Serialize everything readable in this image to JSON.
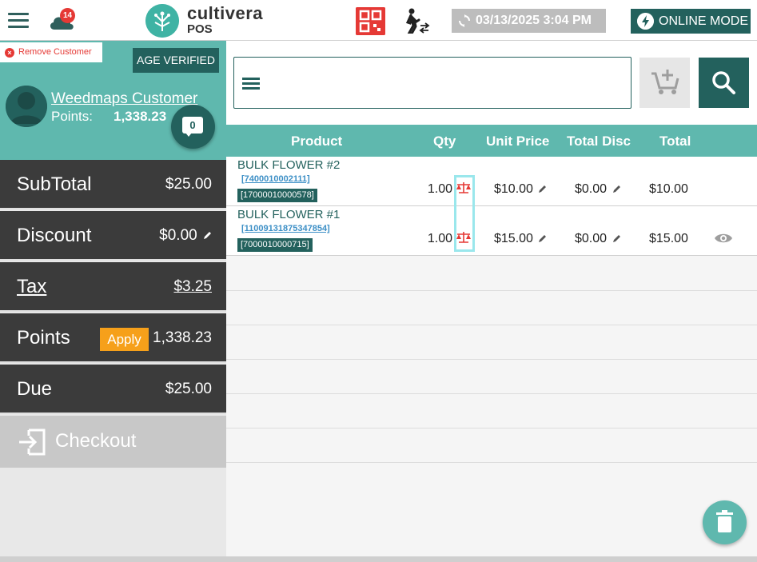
{
  "header": {
    "cloud_badge": "14",
    "logo_text": "cultivera",
    "logo_sub": "POS",
    "datetime": "03/13/2025 3:04 PM",
    "mode_label": "ONLINE MODE"
  },
  "customer": {
    "remove_label": "Remove Customer",
    "age_badge": "AGE VERIFIED",
    "name": "Weedmaps Customer",
    "points_label": "Points:",
    "points_value": "1,338.23",
    "chat_count": "0"
  },
  "summary": {
    "subtotal_label": "SubTotal",
    "subtotal_value": "$25.00",
    "discount_label": "Discount",
    "discount_value": "$0.00",
    "tax_label": "Tax",
    "tax_value": "$3.25",
    "points_label": "Points",
    "apply_label": "Apply",
    "points_value": "1,338.23",
    "due_label": "Due",
    "due_value": "$25.00",
    "checkout_label": "Checkout"
  },
  "table": {
    "headers": [
      "Product",
      "Qty",
      "Unit Price",
      "Total Disc",
      "Total"
    ],
    "rows": [
      {
        "name": "BULK FLOWER #2",
        "sku1": "[7400010002111]",
        "sku2": "[17000010000578]",
        "qty": "1.00",
        "unit_price": "$10.00",
        "total_disc": "$0.00",
        "total": "$10.00"
      },
      {
        "name": "BULK FLOWER #1",
        "sku1": "[11009131875347854]",
        "sku2": "[7000010000715]",
        "qty": "1.00",
        "unit_price": "$15.00",
        "total_disc": "$0.00",
        "total": "$15.00"
      }
    ]
  },
  "colors": {
    "brand_dark": "#23615d",
    "brand_light": "#5fb8ae",
    "accent_red": "#e53935",
    "accent_orange": "#f6a01a"
  }
}
